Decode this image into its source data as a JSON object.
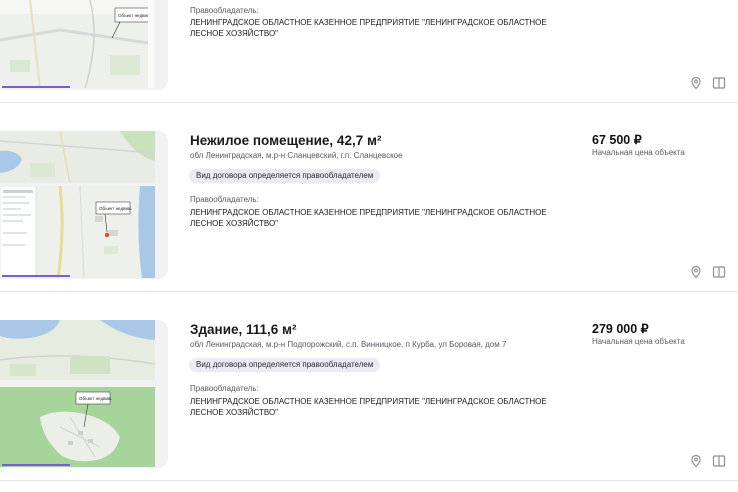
{
  "listings": [
    {
      "owner_label": "Правообладатель:",
      "owner_name": "ЛЕНИНГРАДСКОЕ ОБЛАСТНОЕ КАЗЕННОЕ ПРЕДПРИЯТИЕ \"ЛЕНИНГРАДСКОЕ ОБЛАСТНОЕ ЛЕСНОЕ ХОЗЯЙСТВО\"",
      "map_label": "Объект недвиж."
    },
    {
      "title": "Нежилое помещение, 42,7 м²",
      "address": "обл Ленинградская, м.р-н Сланцевский, г.п. Сланцевское",
      "badge": "Вид договора определяется правообладателем",
      "owner_label": "Правообладатель:",
      "owner_name": "ЛЕНИНГРАДСКОЕ ОБЛАСТНОЕ КАЗЕННОЕ ПРЕДПРИЯТИЕ \"ЛЕНИНГРАДСКОЕ ОБЛАСТНОЕ ЛЕСНОЕ ХОЗЯЙСТВО\"",
      "price": "67 500 ₽",
      "price_label": "Начальная цена объекта",
      "map_label": "Объект недвиж."
    },
    {
      "title": "Здание, 111,6 м²",
      "address": "обл Ленинградская, м.р-н Подпорожский, с.п. Винницкое, п Курба, ул Боровая, дом 7",
      "badge": "Вид договора определяется правообладателем",
      "owner_label": "Правообладатель:",
      "owner_name": "ЛЕНИНГРАДСКОЕ ОБЛАСТНОЕ КАЗЕННОЕ ПРЕДПРИЯТИЕ \"ЛЕНИНГРАДСКОЕ ОБЛАСТНОЕ ЛЕСНОЕ ХОЗЯЙСТВО\"",
      "price": "279 000 ₽",
      "price_label": "Начальная цена объекта",
      "map_label": "Объект недвиж."
    }
  ],
  "icons": {
    "map": "map-pin-icon",
    "compare": "book-compare-icon"
  },
  "colors": {
    "accent": "#7b5cd6",
    "badge_bg": "#eceaf7",
    "icon": "#8a8f99",
    "water": "#a9c8e8",
    "forest": "#a6d49b"
  }
}
